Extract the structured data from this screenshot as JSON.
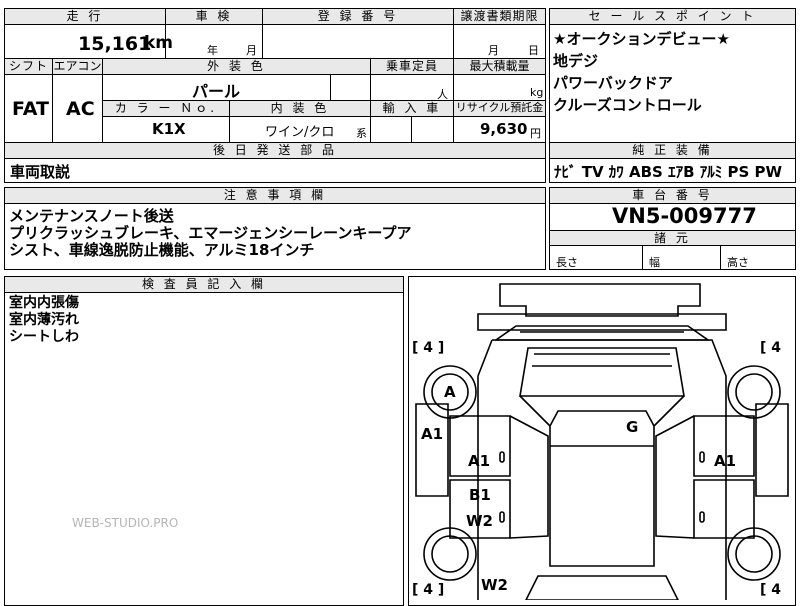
{
  "top_table": {
    "headers": {
      "mileage": "走 行",
      "inspection": "車 検",
      "registration": "登 録 番 号",
      "transfer_deadline": "譲渡書類期限",
      "shift": "シフト",
      "aircon": "エアコン",
      "exterior_color": "外 装 色",
      "capacity": "乗車定員",
      "max_load": "最大積載量",
      "color_no": "カ ラ ー Ｎｏ.",
      "interior_color": "内 装 色",
      "import": "輸 入 車",
      "recycle": "リサイクル預託金",
      "parts_later": "後 日 発 送 部 品"
    },
    "mileage_value": "15,161",
    "mileage_unit": "km",
    "inspection_year": "年",
    "inspection_month": "月",
    "transfer_month": "月",
    "transfer_day": "日",
    "shift_value": "FAT",
    "aircon_value": "AC",
    "exterior_color_value": "パール",
    "capacity_unit": "人",
    "max_load_unit": "kg",
    "color_no_value": "K1X",
    "interior_color_value": "ワイン/クロ",
    "interior_suffix": "系",
    "recycle_value": "9,630",
    "recycle_unit": "円",
    "parts_later_value": "車両取説"
  },
  "sales_points": {
    "header": "セ ー ル ス ポ イ ン ト",
    "items": [
      "★オークションデビュー★",
      "地デジ",
      "パワーバックドア",
      "クルーズコントロール"
    ]
  },
  "equipment": {
    "header": "純 正 装 備",
    "value": "ﾅﾋﾞ TV ｶﾜ ABS ｴｱB ｱﾙﾐ PS PW"
  },
  "notes": {
    "header": "注 意 事 項 欄",
    "lines": [
      "メンテナンスノート後送",
      "プリクラッシュブレーキ、エマージェンシーレーンキープア",
      "シスト、車線逸脱防止機能、アルミ18インチ"
    ]
  },
  "chassis": {
    "header": "車 台 番 号",
    "value": "VN5-009777"
  },
  "specs": {
    "header": "諸 元",
    "length": "長さ",
    "width": "幅",
    "height": "高さ"
  },
  "inspector": {
    "header": "検 査 員 記 入 欄",
    "lines": [
      "室内内張傷",
      "室内薄汚れ",
      "シートしわ"
    ]
  },
  "diagram": {
    "tire_tl": "[ 4 ]",
    "tire_tr": "[ 4",
    "tire_bl": "[ 4 ]",
    "tire_br": "[ 4",
    "marks": {
      "a_front": "A",
      "a1_left": "A1",
      "g_roof": "G",
      "a1_left_door": "A1",
      "a1_right_door": "A1",
      "b1_left": "B1",
      "w2_left": "W2",
      "w2_rear": "W2"
    }
  },
  "watermark": "WEB-STUDIO.PRO"
}
